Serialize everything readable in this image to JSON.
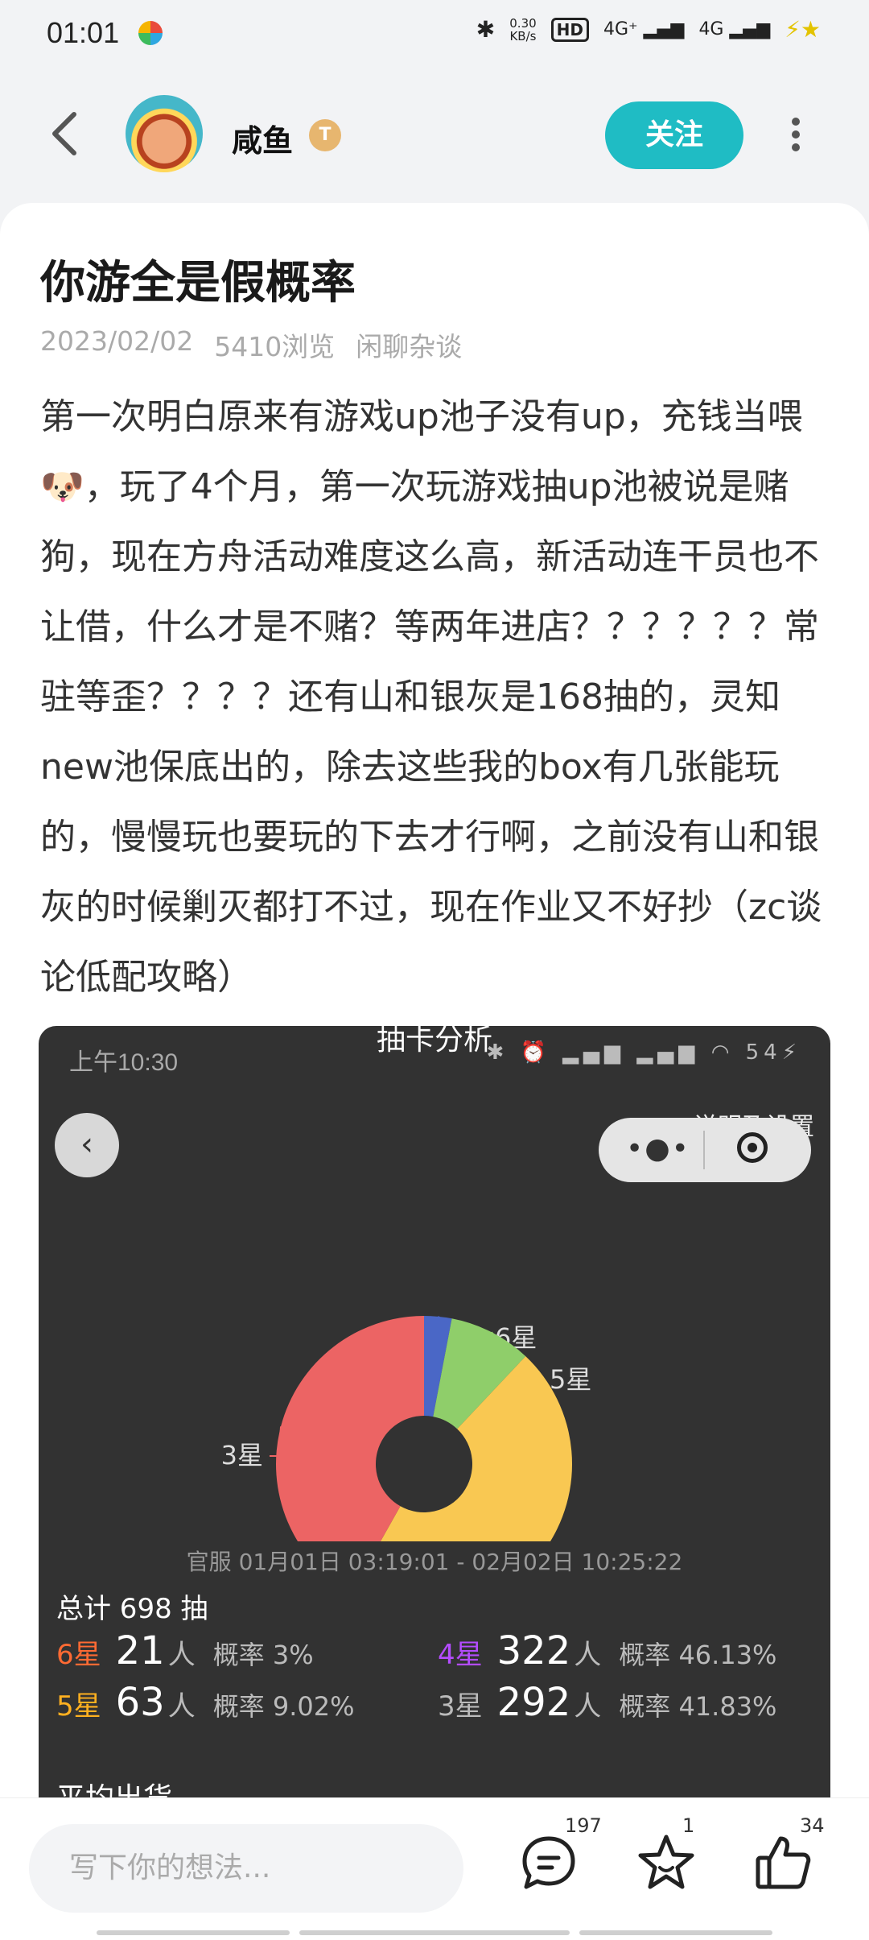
{
  "status_bar": {
    "time": "01:01",
    "network_speed_top": "0.30",
    "network_speed_unit": "KB/s",
    "hd_label": "HD",
    "signal1": "4G⁺",
    "signal2": "4G"
  },
  "header": {
    "username": "咸鱼",
    "badge_text": "T",
    "follow_label": "关注"
  },
  "post": {
    "title": "你游全是假概率",
    "date": "2023/02/02",
    "views": "5410浏览",
    "category": "闲聊杂谈",
    "body": "第一次明白原来有游戏up池子没有up，充钱当喂🐶，玩了4个月，第一次玩游戏抽up池被说是赌狗，现在方舟活动难度这么高，新活动连干员也不让借，什么才是不赌？等两年进店？？？？？？常驻等歪？？？？还有山和银灰是168抽的，灵知new池保底出的，除去这些我的box有几张能玩的，慢慢玩也要玩的下去才行啊，之前没有山和银灰的时候剿灭都打不过，现在作业又不好抄（zc谈论低配攻略）"
  },
  "screenshot": {
    "title": "抽卡分析",
    "time": "上午10:30",
    "battery": "54",
    "settings_label": "说明及设置",
    "date_range": "官服  01月01日 03:19:01  -  02月02日 10:25:22",
    "total": "总计 698 抽",
    "stats": [
      {
        "star": "6星",
        "count": "21",
        "unit": "人",
        "rate": "概率 3%",
        "color": "#ff6a33"
      },
      {
        "star": "4星",
        "count": "322",
        "unit": "人",
        "rate": "概率 46.13%",
        "color": "#b44cff"
      },
      {
        "star": "5星",
        "count": "63",
        "unit": "人",
        "rate": "概率 9.02%",
        "color": "#ffb020"
      },
      {
        "star": "3星",
        "count": "292",
        "unit": "人",
        "rate": "概率 41.83%",
        "color": "#bbbbbb"
      }
    ],
    "avg_label": "平均出货"
  },
  "chart_data": {
    "type": "pie",
    "categories": [
      "6星",
      "5星",
      "4星",
      "3星"
    ],
    "values": [
      21,
      63,
      322,
      292
    ],
    "colors": [
      "#4a67c6",
      "#8fce6a",
      "#f9c852",
      "#ec6464"
    ]
  },
  "bottom_bar": {
    "comment_placeholder": "写下你的想法...",
    "comment_count": "197",
    "star_count": "1",
    "like_count": "34"
  }
}
